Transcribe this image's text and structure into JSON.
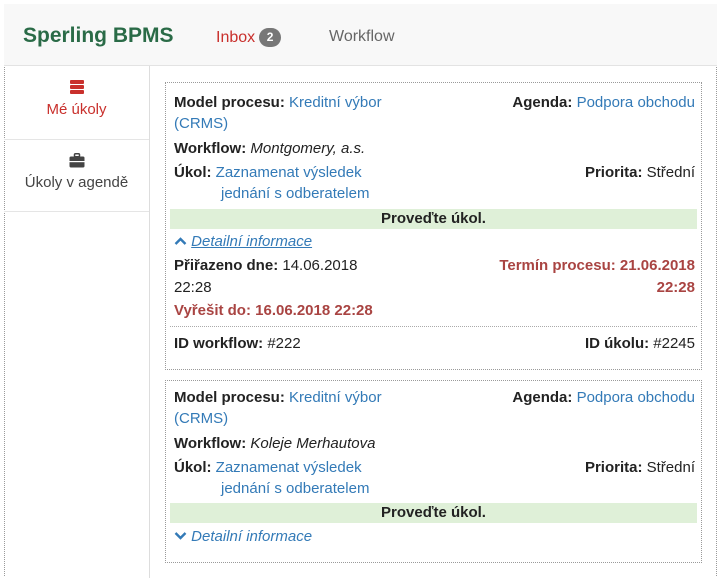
{
  "navbar": {
    "brand": "Sperling BPMS",
    "inbox_label": "Inbox",
    "inbox_count": "2",
    "workflow_label": "Workflow"
  },
  "sidebar": {
    "items": [
      {
        "label": "Mé úkoly",
        "icon": "stack-icon",
        "active": true
      },
      {
        "label": "Úkoly v agendě",
        "icon": "briefcase-icon",
        "active": false
      }
    ]
  },
  "labels": {
    "model": "Model procesu:",
    "agenda": "Agenda:",
    "workflow": "Workflow:",
    "task": "Úkol:",
    "priority": "Priorita:",
    "action": "Proveďte úkol.",
    "details": "Detailní informace",
    "assigned": "Přiřazeno dne:",
    "deadline": "Termín procesu:",
    "solve_by": "Vyřešit do:",
    "workflow_id": "ID workflow:",
    "task_id": "ID úkolu:"
  },
  "tasks": [
    {
      "model_line1": "Kreditní výbor",
      "model_line2": "(CRMS)",
      "agenda": "Podpora obchodu",
      "workflow": "Montgomery, a.s.",
      "task_line1": "Zaznamenat výsledek",
      "task_line2": "jednání s odberatelem",
      "priority": "Střední",
      "assigned_line1": "14.06.2018",
      "assigned_line2": "22:28",
      "deadline_line1": "21.06.2018",
      "deadline_line2": "22:28",
      "solve_by": "16.06.2018 22:28",
      "workflow_id": "#222",
      "task_id": "#2245",
      "expanded": true
    },
    {
      "model_line1": "Kreditní výbor",
      "model_line2": "(CRMS)",
      "agenda": "Podpora obchodu",
      "workflow": "Koleje Merhautova",
      "task_line1": "Zaznamenat výsledek",
      "task_line2": "jednání s odberatelem",
      "priority": "Střední",
      "expanded": false
    }
  ],
  "colors": {
    "brand": "#2a6b47",
    "active": "#c9302c",
    "link": "#337ab7",
    "success_bg": "#dff0d8",
    "danger_text": "#a94442"
  }
}
